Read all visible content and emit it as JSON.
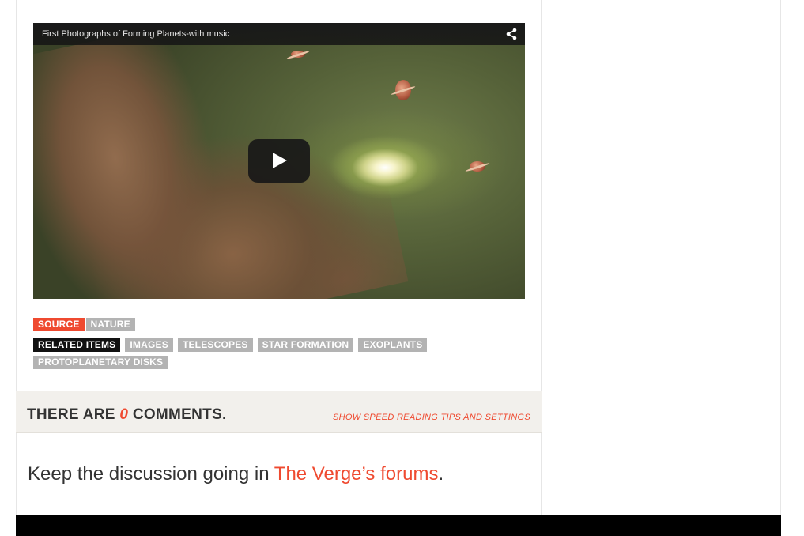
{
  "video": {
    "title": "First Photographs of Forming Planets-with music"
  },
  "tags": {
    "source_label": "SOURCE",
    "source_items": [
      "NATURE"
    ],
    "related_label": "RELATED ITEMS",
    "related_items": [
      "IMAGES",
      "TELESCOPES",
      "STAR FORMATION",
      "EXOPLANTS",
      "PROTOPLANETARY DISKS"
    ]
  },
  "comments": {
    "prefix": "THERE ARE ",
    "count": "0",
    "suffix": " COMMENTS.",
    "speed_link": "SHOW SPEED READING TIPS AND SETTINGS"
  },
  "discussion": {
    "prefix": "Keep the discussion going in ",
    "link_text": "The Verge’s forums",
    "suffix": "."
  },
  "colors": {
    "accent": "#ef4a30",
    "tag_gray": "#b3b3b3",
    "footer": "#000000"
  }
}
